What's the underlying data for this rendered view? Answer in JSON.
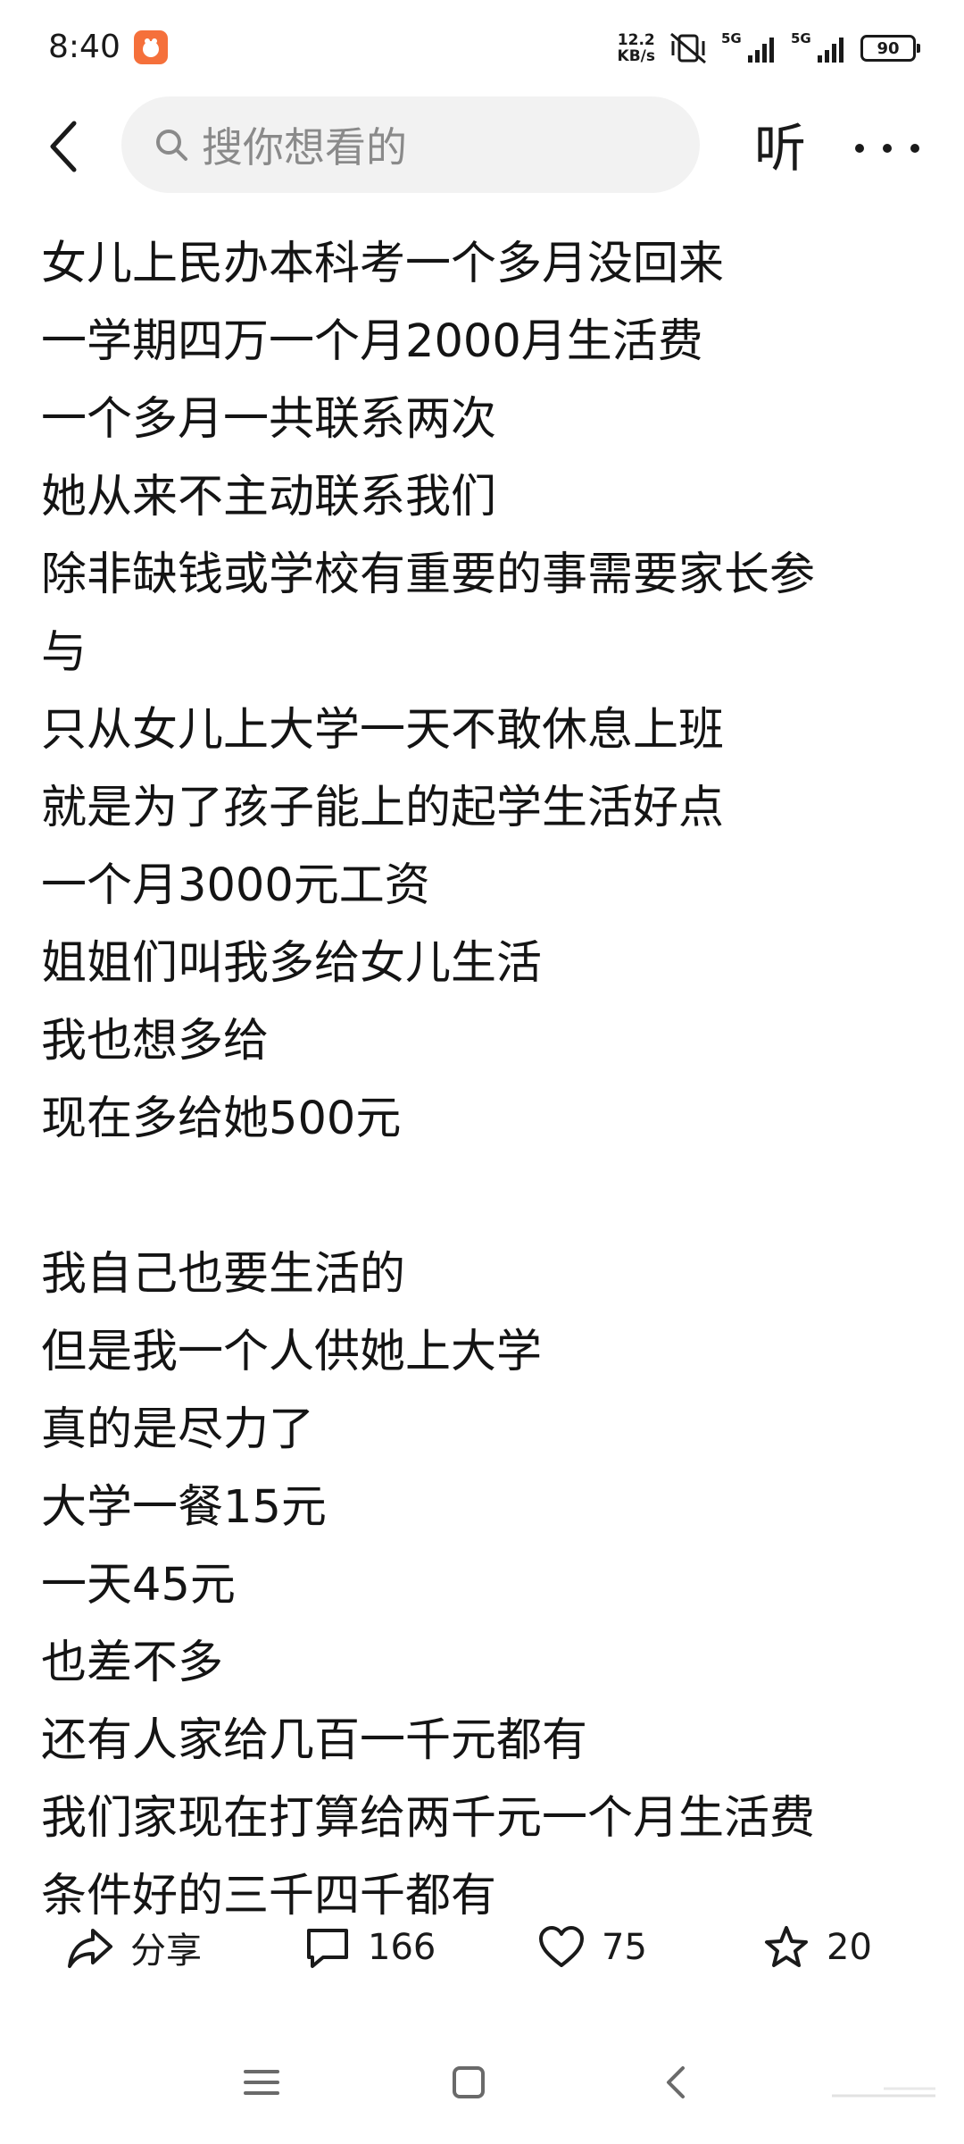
{
  "status_bar": {
    "time": "8:40",
    "net_speed_value": "12.2",
    "net_speed_unit": "KB/s",
    "sim1_label": "5G",
    "sim2_label": "5G",
    "battery": "90",
    "icons": [
      "app-notification-icon",
      "mute-vibrate-icon",
      "signal-icon",
      "signal-icon",
      "battery-icon"
    ]
  },
  "top_bar": {
    "search_placeholder": "搜你想看的",
    "listen_label": "听",
    "icons": [
      "back-icon",
      "search-icon",
      "more-icon"
    ]
  },
  "post": {
    "lines": [
      "女儿上民办本科考一个多月没回来",
      "一学期四万一个月2000月生活费",
      "一个多月一共联系两次",
      "她从来不主动联系我们",
      "除非缺钱或学校有重要的事需要家长参",
      "与",
      "只从女儿上大学一天不敢休息上班",
      "就是为了孩子能上的起学生活好点",
      "一个月3000元工资",
      "姐姐们叫我多给女儿生活",
      "我也想多给",
      "现在多给她500元",
      "",
      "我自己也要生活的",
      "但是我一个人供她上大学",
      "真的是尽力了",
      "大学一餐15元",
      "一天45元",
      "也差不多",
      "还有人家给几百一千元都有",
      "我们家现在打算给两千元一个月生活费",
      "条件好的三千四千都有"
    ]
  },
  "actions": {
    "share_label": "分享",
    "comment_count": "166",
    "like_count": "75",
    "favorite_count": "20",
    "icons": [
      "share-icon",
      "comment-icon",
      "heart-icon",
      "star-icon"
    ]
  },
  "nav_bar": {
    "icons": [
      "menu-icon",
      "home-icon",
      "back-nav-icon"
    ]
  }
}
